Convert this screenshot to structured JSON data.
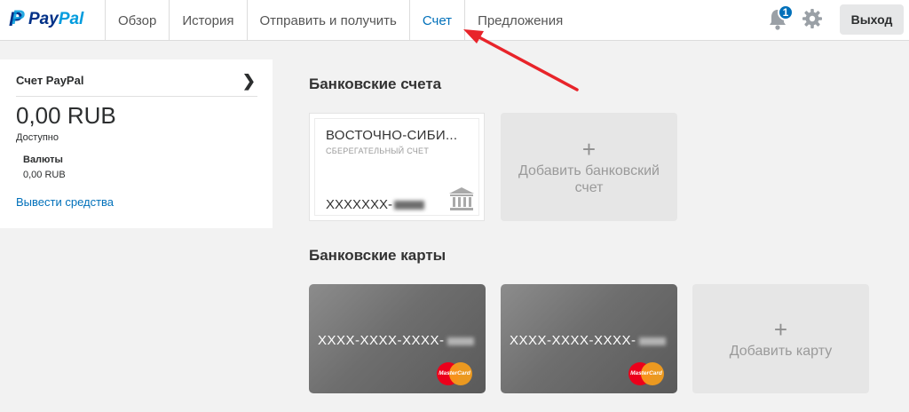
{
  "header": {
    "logo": "PayPal",
    "nav": [
      {
        "label": "Обзор",
        "active": false
      },
      {
        "label": "История",
        "active": false
      },
      {
        "label": "Отправить и получить",
        "active": false
      },
      {
        "label": "Счет",
        "active": true
      },
      {
        "label": "Предложения",
        "active": false
      }
    ],
    "notifications_count": "1",
    "bell_icon": "bell-icon",
    "settings_icon": "gear-icon",
    "logout_label": "Выход"
  },
  "account_panel": {
    "title": "Счет PayPal",
    "balance": "0,00 RUB",
    "available_label": "Доступно",
    "currencies_label": "Валюты",
    "currency_value": "0,00 RUB",
    "withdraw_link": "Вывести средства"
  },
  "bank_accounts": {
    "title": "Банковские счета",
    "accounts": [
      {
        "name": "ВОСТОЧНО-СИБИ...",
        "type": "СБЕРЕГАТЕЛЬНЫЙ СЧЕТ",
        "number": "XXXXXXX-"
      }
    ],
    "add_label": "Добавить банковский счет"
  },
  "bank_cards": {
    "title": "Банковские карты",
    "cards": [
      {
        "number": "XXXX-XXXX-XXXX-",
        "brand": "MasterCard"
      },
      {
        "number": "XXXX-XXXX-XXXX-",
        "brand": "MasterCard"
      }
    ],
    "add_label": "Добавить карту"
  },
  "colors": {
    "accent": "#0070ba",
    "annotation_arrow": "#e8242a",
    "paypal_dark": "#003087",
    "paypal_light": "#009cde"
  }
}
